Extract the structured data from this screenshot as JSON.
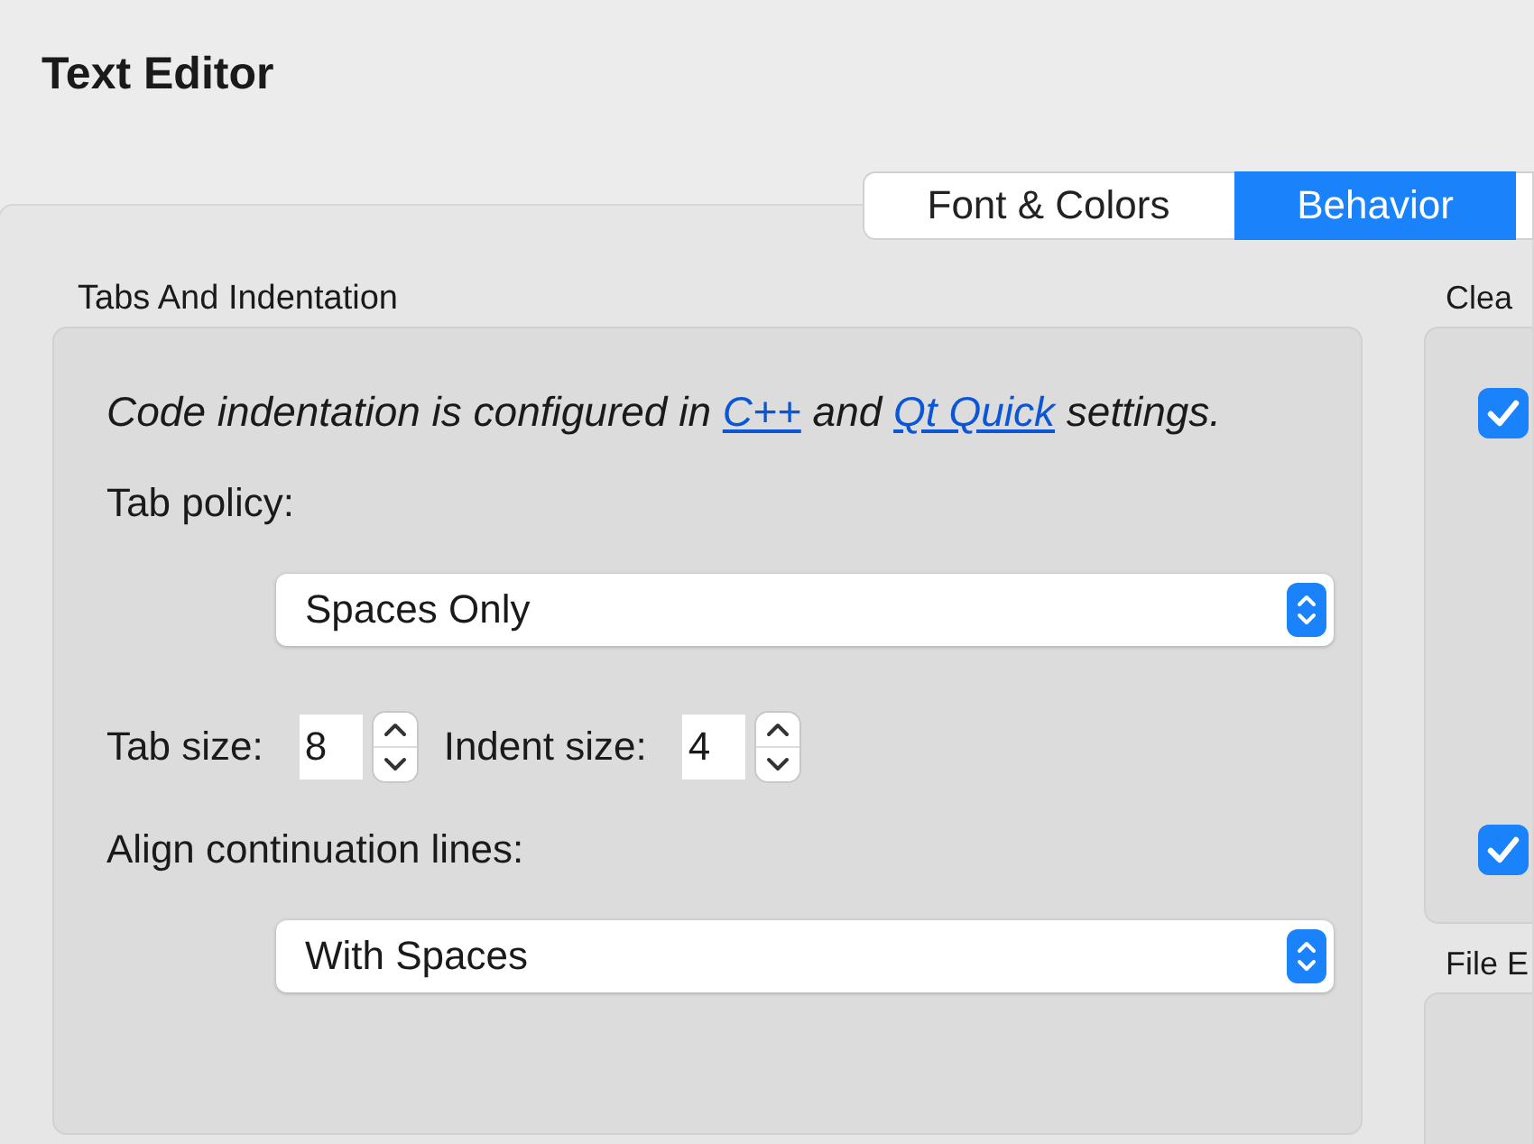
{
  "title": "Text Editor",
  "tabs": [
    {
      "label": "Font & Colors",
      "selected": false
    },
    {
      "label": "Behavior",
      "selected": true
    }
  ],
  "indentation": {
    "title": "Tabs And Indentation",
    "note": [
      {
        "kind": "text",
        "text": "Code indentation is configured in"
      },
      {
        "kind": "link",
        "text": "C++"
      },
      {
        "kind": "text",
        "text": "and"
      },
      {
        "kind": "link",
        "text": "Qt Quick"
      },
      {
        "kind": "text",
        "text": "settings."
      }
    ],
    "tab_policy_label": "Tab policy:",
    "tab_policy": "Spaces Only",
    "tab_size_label": "Tab size:",
    "tab_size": "8",
    "indent_size_label": "Indent size:",
    "indent_size": "4",
    "align_label": "Align continuation lines:",
    "align": "With Spaces"
  },
  "cleanup": {
    "title": "Clea",
    "checkboxes": [
      {
        "checked": true
      },
      {
        "checked": true
      }
    ]
  },
  "file": {
    "title": "File E"
  }
}
